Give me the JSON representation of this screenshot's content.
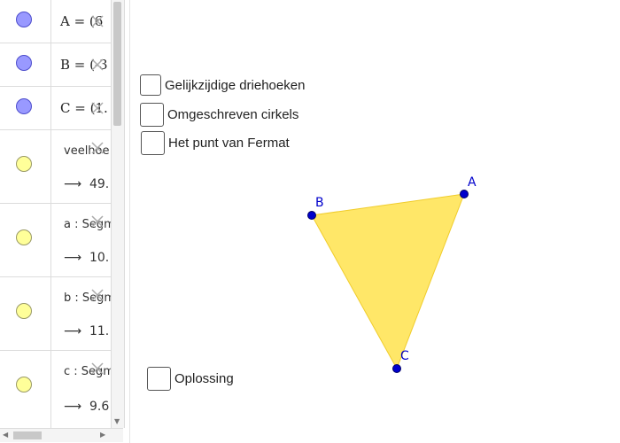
{
  "algebra": {
    "items": [
      {
        "definition": "A = (6",
        "value": ""
      },
      {
        "definition": "B = (-3",
        "value": ""
      },
      {
        "definition": "C = (1.",
        "value": ""
      },
      {
        "definition": "veelhoe",
        "value": "49."
      },
      {
        "definition": "a : Segm",
        "value": "10."
      },
      {
        "definition": "b : Segm",
        "value": "11."
      },
      {
        "definition": "c : Segm",
        "value": "9.6"
      }
    ],
    "arrow": "⟶"
  },
  "checkboxes": {
    "equilateral": {
      "label": "Gelijkzijdige driehoeken",
      "checked": false
    },
    "circumscribed": {
      "label": "Omgeschreven cirkels",
      "checked": false
    },
    "fermat": {
      "label": "Het punt van Fermat",
      "checked": false
    },
    "solution": {
      "label": "Oplossing",
      "checked": false
    }
  },
  "triangle": {
    "fill_color": "#ffe34d",
    "point_color": "#0000cc",
    "points": {
      "A": {
        "label": "A"
      },
      "B": {
        "label": "B"
      },
      "C": {
        "label": "C"
      }
    }
  },
  "colors": {
    "point_dot": "#9999ff",
    "polygon_dot": "#ffff99"
  }
}
